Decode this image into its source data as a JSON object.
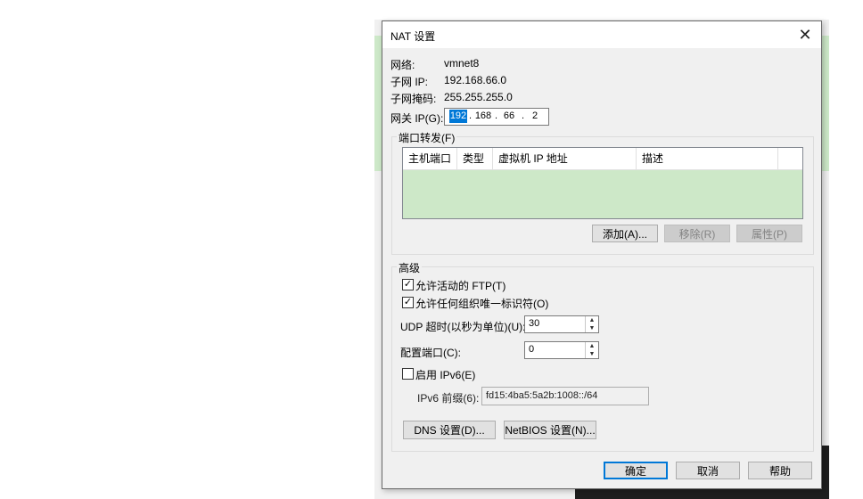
{
  "dialog": {
    "title": "NAT 设置",
    "close_glyph": "✕"
  },
  "info": {
    "network_label": "网络:",
    "network_value": "vmnet8",
    "subnet_ip_label": "子网 IP:",
    "subnet_ip_value": "192.168.66.0",
    "subnet_mask_label": "子网掩码:",
    "subnet_mask_value": "255.255.255.0",
    "gateway_label": "网关 IP(G):",
    "gateway_octets": [
      "192",
      "168",
      "66",
      "2"
    ]
  },
  "port_forwarding": {
    "title": "端口转发(F)",
    "columns": [
      "主机端口",
      "类型",
      "虚拟机 IP 地址",
      "描述"
    ],
    "rows": [],
    "add_button": "添加(A)...",
    "remove_button": "移除(R)",
    "properties_button": "属性(P)"
  },
  "advanced": {
    "title": "高级",
    "allow_ftp": {
      "label": "允许活动的 FTP(T)",
      "checked": true
    },
    "allow_oui": {
      "label": "允许任何组织唯一标识符(O)",
      "checked": true
    },
    "udp_timeout_label": "UDP 超时(以秒为单位)(U):",
    "udp_timeout_value": "30",
    "config_port_label": "配置端口(C):",
    "config_port_value": "0",
    "enable_ipv6": {
      "label": "启用 IPv6(E)",
      "checked": false
    },
    "ipv6_prefix_label": "IPv6 前缀(6):",
    "ipv6_prefix_value": "fd15:4ba5:5a2b:1008::/64",
    "dns_button": "DNS 设置(D)...",
    "netbios_button": "NetBIOS 设置(N)..."
  },
  "footer": {
    "ok_button": "确定",
    "cancel_button": "取消",
    "help_button": "帮助"
  },
  "colors": {
    "accent": "#0078d7",
    "table_background": "#cde8c8"
  }
}
